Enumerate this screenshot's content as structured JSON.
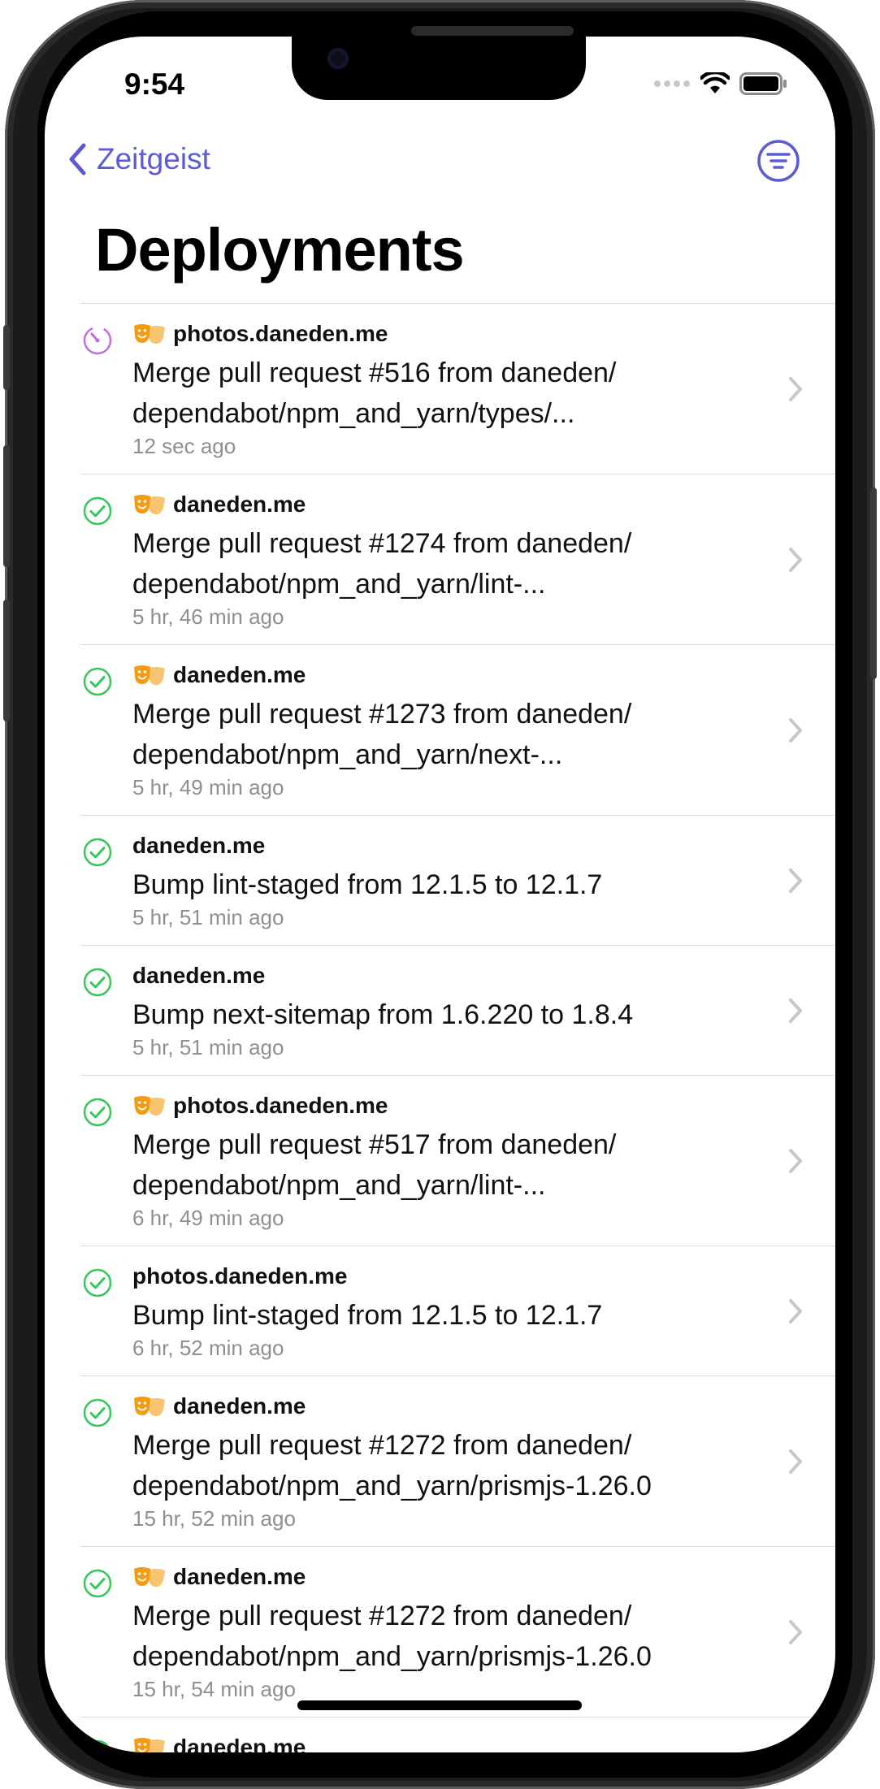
{
  "status_bar": {
    "time": "9:54"
  },
  "nav": {
    "back_label": "Zeitgeist",
    "title": "Deployments"
  },
  "colors": {
    "accent": "#5b5bd6",
    "success": "#34c759",
    "building": "#c36be6",
    "badge": "#f39c12",
    "chevron": "#c7c7cc"
  },
  "deployments": [
    {
      "status": "building",
      "has_badge": true,
      "project": "photos.daneden.me",
      "message_line1": "Merge pull request #516 from daneden/",
      "message_line2": "dependabot/npm_and_yarn/types/...",
      "ago": "12 sec ago"
    },
    {
      "status": "ready",
      "has_badge": true,
      "project": "daneden.me",
      "message_line1": "Merge pull request #1274 from daneden/",
      "message_line2": "dependabot/npm_and_yarn/lint-...",
      "ago": "5 hr, 46 min ago"
    },
    {
      "status": "ready",
      "has_badge": true,
      "project": "daneden.me",
      "message_line1": "Merge pull request #1273 from daneden/",
      "message_line2": "dependabot/npm_and_yarn/next-...",
      "ago": "5 hr, 49 min ago"
    },
    {
      "status": "ready",
      "has_badge": false,
      "project": "daneden.me",
      "message_line1": "Bump lint-staged from 12.1.5 to 12.1.7",
      "message_line2": "",
      "ago": "5 hr, 51 min ago"
    },
    {
      "status": "ready",
      "has_badge": false,
      "project": "daneden.me",
      "message_line1": "Bump next-sitemap from 1.6.220 to 1.8.4",
      "message_line2": "",
      "ago": "5 hr, 51 min ago"
    },
    {
      "status": "ready",
      "has_badge": true,
      "project": "photos.daneden.me",
      "message_line1": "Merge pull request #517 from daneden/",
      "message_line2": "dependabot/npm_and_yarn/lint-...",
      "ago": "6 hr, 49 min ago"
    },
    {
      "status": "ready",
      "has_badge": false,
      "project": "photos.daneden.me",
      "message_line1": "Bump lint-staged from 12.1.5 to 12.1.7",
      "message_line2": "",
      "ago": "6 hr, 52 min ago"
    },
    {
      "status": "ready",
      "has_badge": true,
      "project": "daneden.me",
      "message_line1": "Merge pull request #1272 from daneden/",
      "message_line2": "dependabot/npm_and_yarn/prismjs-1.26.0",
      "ago": "15 hr, 52 min ago"
    },
    {
      "status": "ready",
      "has_badge": true,
      "project": "daneden.me",
      "message_line1": "Merge pull request #1272 from daneden/",
      "message_line2": "dependabot/npm_and_yarn/prismjs-1.26.0",
      "ago": "15 hr, 54 min ago"
    },
    {
      "status": "ready",
      "has_badge": true,
      "project": "daneden.me",
      "message_line1": "",
      "message_line2": "",
      "ago": ""
    }
  ]
}
